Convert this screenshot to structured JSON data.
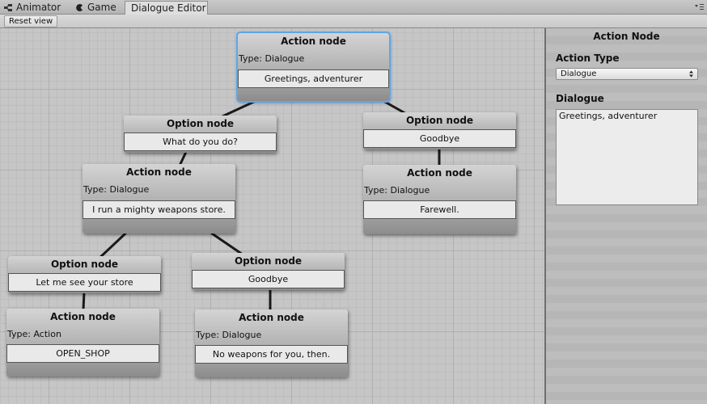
{
  "tabs": [
    {
      "label": "Animator",
      "icon": "animator-icon",
      "active": false
    },
    {
      "label": "Game",
      "icon": "game-icon",
      "active": false
    },
    {
      "label": "Dialogue Editor",
      "active": true
    }
  ],
  "toolbar": {
    "reset_label": "Reset view"
  },
  "nodes": {
    "root_action": {
      "title": "Action node",
      "type": "Type: Dialogue",
      "value": "Greetings, adventurer",
      "selected": true
    },
    "opt_what": {
      "title": "Option node",
      "value": "What do you do?"
    },
    "opt_goodbye_1": {
      "title": "Option node",
      "value": "Goodbye"
    },
    "act_weapons": {
      "title": "Action node",
      "type": "Type: Dialogue",
      "value": "I run a mighty weapons store."
    },
    "act_farewell": {
      "title": "Action node",
      "type": "Type: Dialogue",
      "value": "Farewell."
    },
    "opt_store": {
      "title": "Option node",
      "value": "Let me see your store"
    },
    "opt_goodbye_2": {
      "title": "Option node",
      "value": "Goodbye"
    },
    "act_shop": {
      "title": "Action node",
      "type": "Type: Action",
      "value": "OPEN_SHOP"
    },
    "act_noweapons": {
      "title": "Action node",
      "type": "Type: Dialogue",
      "value": "No weapons for you, then."
    }
  },
  "inspector": {
    "title": "Action Node",
    "action_type_label": "Action Type",
    "action_type_value": "Dialogue",
    "dialogue_label": "Dialogue",
    "dialogue_value": "Greetings, adventurer"
  },
  "colors": {
    "selection": "#5ea6e6",
    "canvas": "#c6c6c6",
    "connection": "#1a1a1a"
  }
}
